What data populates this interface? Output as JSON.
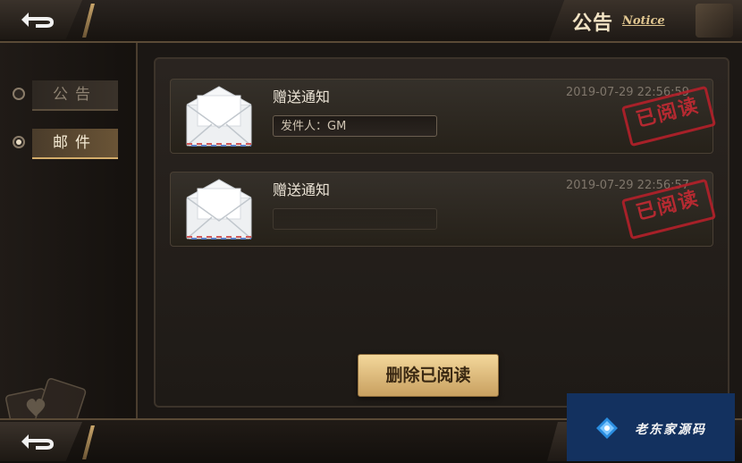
{
  "header": {
    "title": "公告",
    "title_sub": "Notice"
  },
  "sidebar": {
    "tabs": [
      {
        "label": "公告",
        "active": false
      },
      {
        "label": "邮件",
        "active": true
      }
    ]
  },
  "mail_list": [
    {
      "title": "赠送通知",
      "time": "2019-07-29 22:56:59",
      "sender": "发件人：GM",
      "status_stamp": "已阅读"
    },
    {
      "title": "赠送通知",
      "time": "2019-07-29 22:56:57",
      "sender": "",
      "status_stamp": "已阅读"
    }
  ],
  "actions": {
    "delete_read": "删除已阅读"
  },
  "watermark": {
    "text": "老东家源码"
  },
  "colors": {
    "accent_gold": "#d3ac6a",
    "stamp_red": "#c42a33",
    "watermark_bg": "#13315f"
  },
  "icons": [
    "back-arrow-icon",
    "envelope-icon",
    "radio-icon",
    "playing-cards-icon",
    "diamond-logo-icon"
  ]
}
